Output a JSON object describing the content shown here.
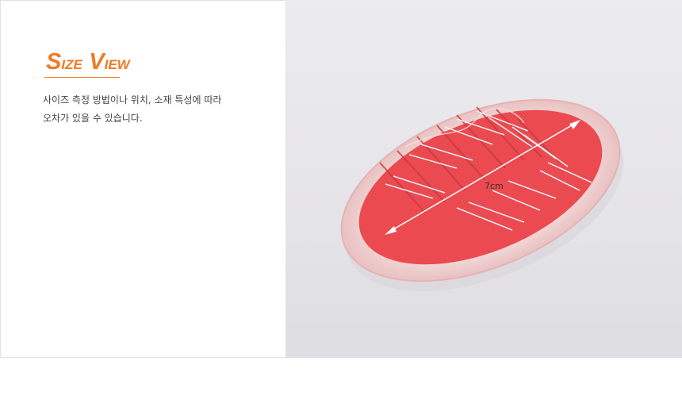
{
  "heading": {
    "word1_first": "S",
    "word1_rest": "IZE",
    "word2_first": "V",
    "word2_rest": "IEW"
  },
  "description": {
    "line1": "사이즈 측정 방법이나 위치, 소재 특성에 따라",
    "line2": "오차가 있을 수 있습니다."
  },
  "photo": {
    "measure_label": "7cm",
    "subject": "needle-case"
  },
  "colors": {
    "accent": "#f07a24",
    "case_red": "#ea4a50",
    "background": "#e7e6ea"
  }
}
